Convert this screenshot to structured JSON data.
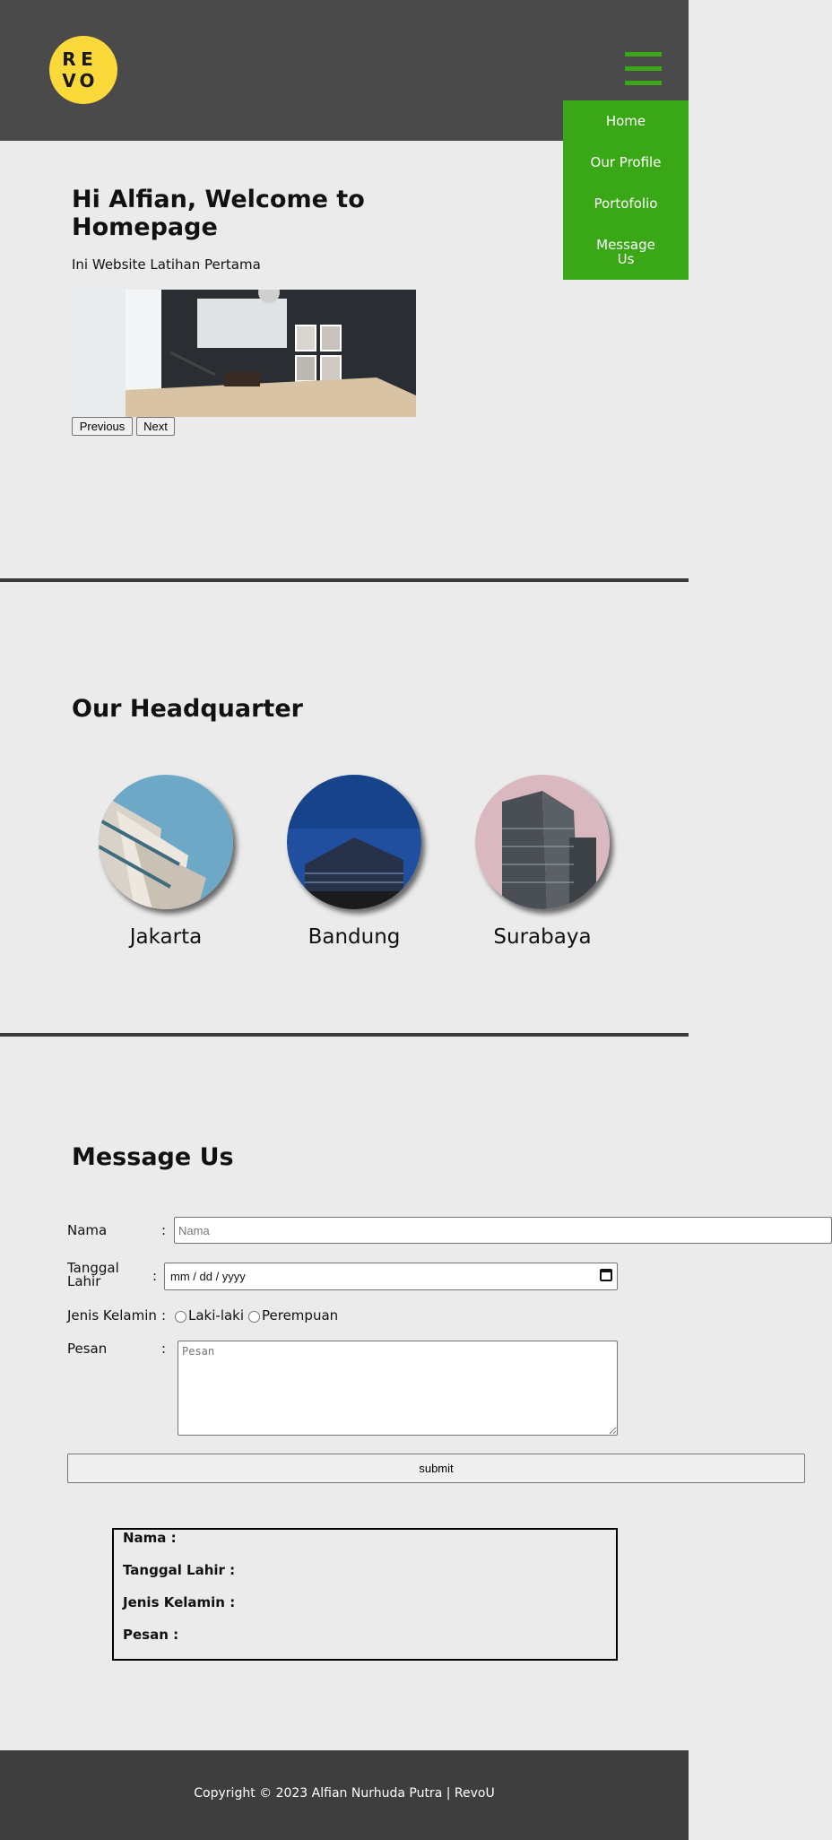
{
  "logo": {
    "letters": [
      "R",
      "E",
      "V",
      "O"
    ],
    "color": "#fcd93a"
  },
  "nav": {
    "items": [
      {
        "label": "Home"
      },
      {
        "label": "Our Profile"
      },
      {
        "label": "Portofolio"
      },
      {
        "label": "Message Us"
      }
    ],
    "accent": "#3aa716"
  },
  "hero": {
    "title": "Hi Alfian, Welcome to Homepage",
    "subtitle": "Ini Website Latihan Pertama",
    "prev_label": "Previous",
    "next_label": "Next"
  },
  "headquarter": {
    "title": "Our Headquarter",
    "cities": [
      {
        "name": "Jakarta"
      },
      {
        "name": "Bandung"
      },
      {
        "name": "Surabaya"
      }
    ]
  },
  "message": {
    "title": "Message Us",
    "nama_label": "Nama",
    "nama_placeholder": "Nama",
    "tanggal_label": "Tanggal Lahir",
    "tanggal_value": "mm / dd / yyyy",
    "gender_label": "Jenis Kelamin",
    "gender_options": [
      "Laki-laki",
      "Perempuan"
    ],
    "pesan_label": "Pesan",
    "pesan_placeholder": "Pesan",
    "colon": ":",
    "submit_label": "submit"
  },
  "result": {
    "nama": "Nama :",
    "tanggal": "Tanggal Lahir :",
    "gender": "Jenis Kelamin :",
    "pesan": "Pesan :"
  },
  "footer": {
    "text": "Copyright © 2023 Alfian Nurhuda Putra | RevoU"
  }
}
